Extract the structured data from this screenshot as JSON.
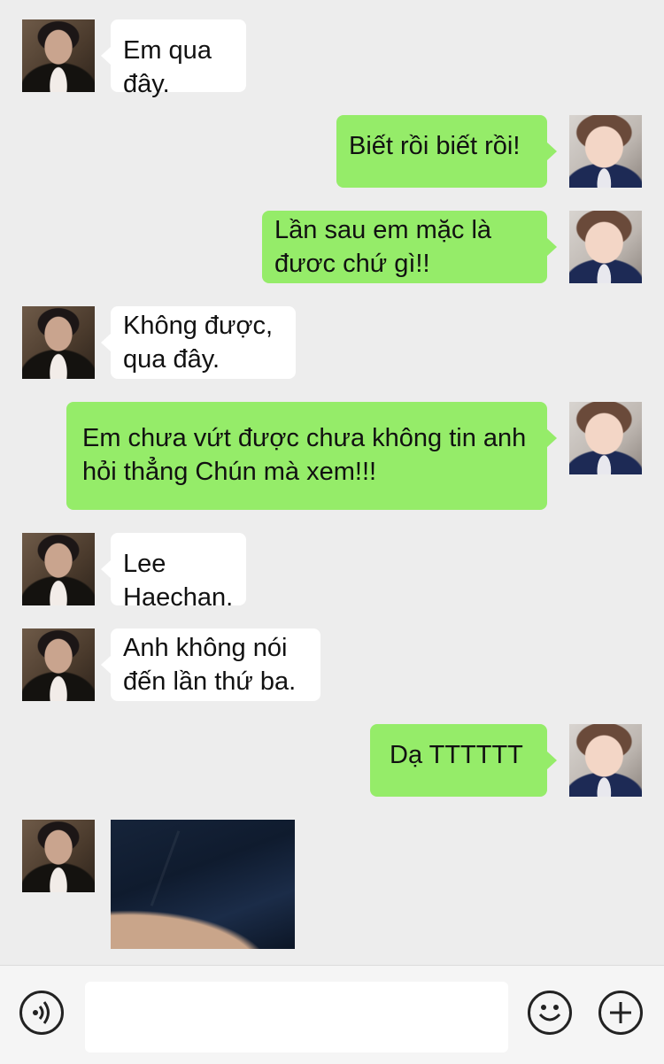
{
  "messages": [
    {
      "side": "left",
      "type": "text",
      "text": "Em qua đây."
    },
    {
      "side": "right",
      "type": "text",
      "text": "Biết rồi biết rồi!"
    },
    {
      "side": "right",
      "type": "text",
      "text": "Lần sau em mặc là\nđươc chứ gì!!"
    },
    {
      "side": "left",
      "type": "text",
      "text": "Không được,\nqua đây."
    },
    {
      "side": "right",
      "type": "text",
      "text": "Em chưa vứt được chưa không tin anh\nhỏi thẳng Chún mà xem!!!"
    },
    {
      "side": "left",
      "type": "text",
      "text": "Lee Haechan."
    },
    {
      "side": "left",
      "type": "text",
      "text": "Anh không nói\nđến lần thứ ba."
    },
    {
      "side": "right",
      "type": "text",
      "text": "Dạ  TTTTTT"
    },
    {
      "side": "left",
      "type": "image",
      "text": ""
    }
  ],
  "input_bar": {
    "voice_icon": "voice-icon",
    "emoji_icon": "emoji-icon",
    "plus_icon": "plus-icon",
    "text_value": ""
  },
  "colors": {
    "background": "#ededed",
    "outgoing_bubble": "#95ec69",
    "incoming_bubble": "#ffffff"
  }
}
